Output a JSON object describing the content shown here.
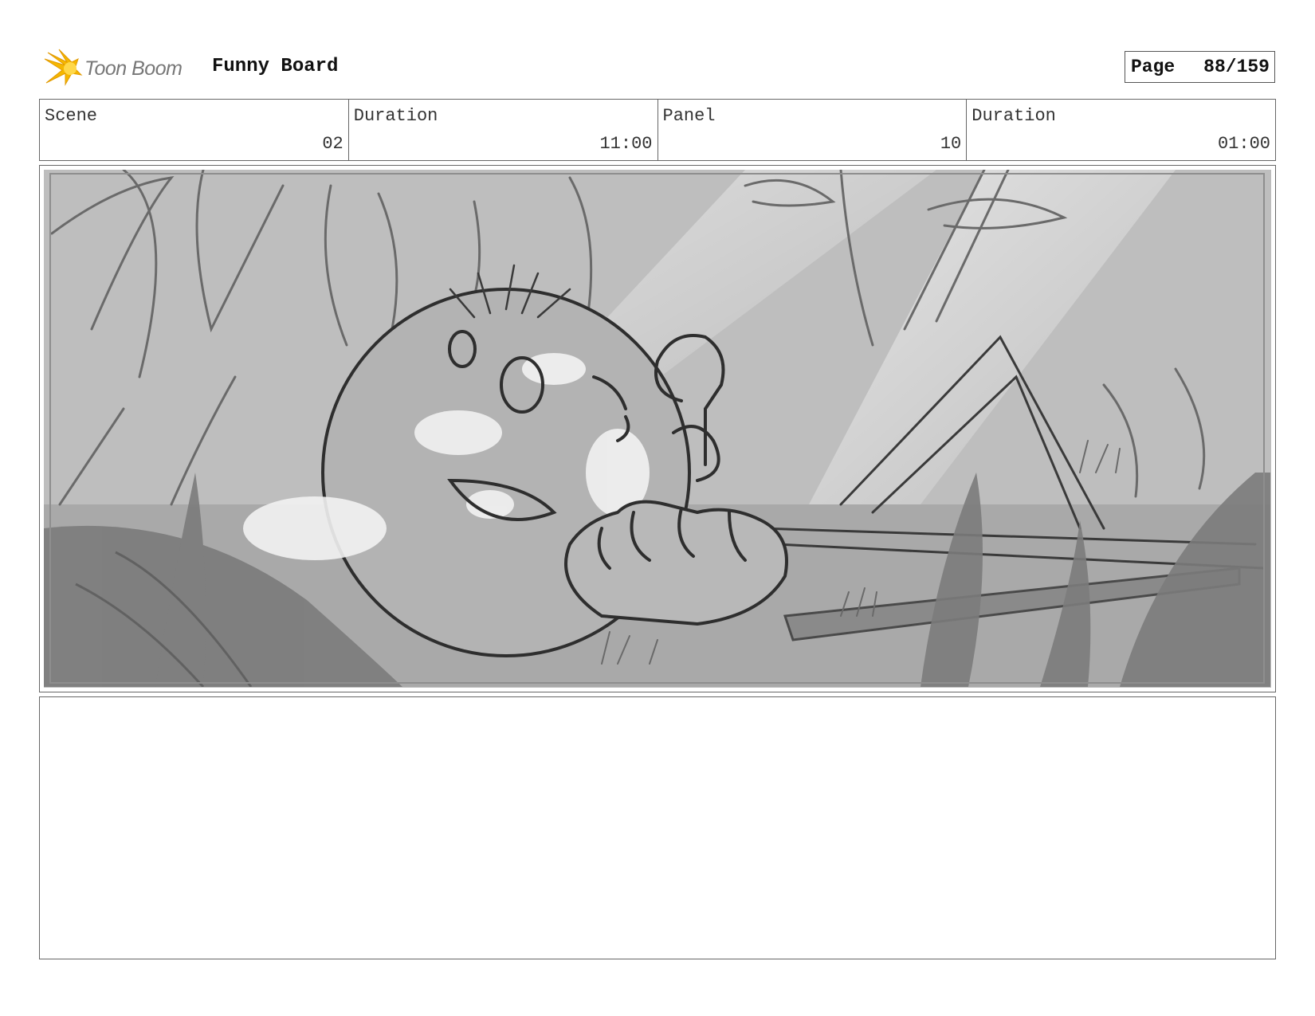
{
  "header": {
    "logo_text": "Toon Boom",
    "board_title": "Funny Board",
    "page_label": "Page",
    "page_value": "88/159"
  },
  "info": [
    {
      "label": "Scene",
      "value": "02"
    },
    {
      "label": "Duration",
      "value": "11:00"
    },
    {
      "label": "Panel",
      "value": "10"
    },
    {
      "label": "Duration",
      "value": "01:00"
    }
  ],
  "colors": {
    "logo_star": "#f5b700",
    "sketch_bg": "#bdbdbd",
    "sketch_dark": "#555555",
    "sketch_highlight": "#f2f2f2"
  },
  "icons": {
    "logo": "toon-boom-star-icon"
  },
  "notes": {
    "text": ""
  }
}
